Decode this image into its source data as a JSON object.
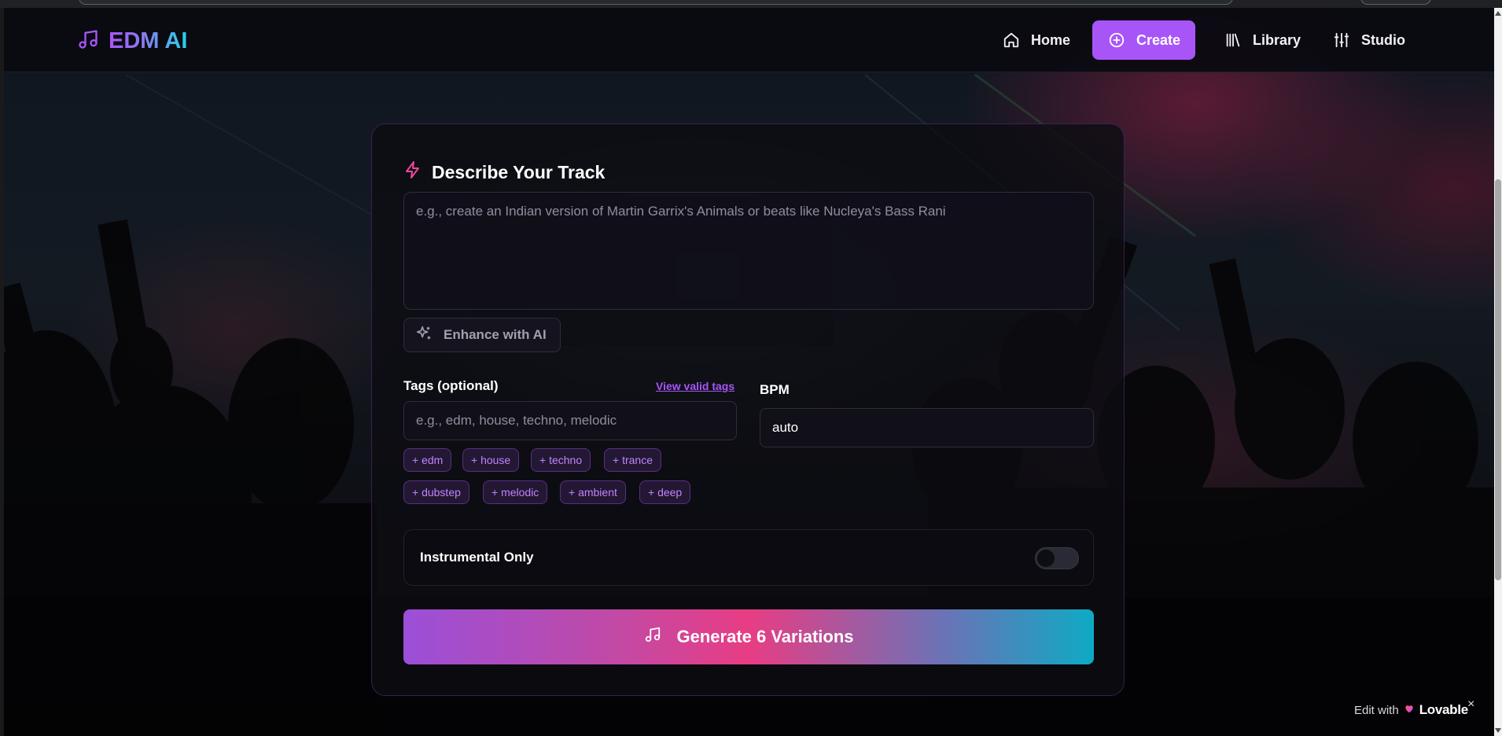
{
  "nav": {
    "logo_text": "EDM AI",
    "items": [
      {
        "label": "Home",
        "icon": "home-icon"
      },
      {
        "label": "Create",
        "icon": "plus-circle-icon",
        "active": true
      },
      {
        "label": "Library",
        "icon": "library-icon"
      },
      {
        "label": "Studio",
        "icon": "sliders-icon"
      }
    ]
  },
  "form": {
    "title": "Describe Your Track",
    "description_placeholder": "e.g., create an Indian version of Martin Garrix's Animals or beats like Nucleya's Bass Rani",
    "enhance_label": "Enhance with AI",
    "tags": {
      "label": "Tags (optional)",
      "view_link": "View valid tags",
      "placeholder": "e.g., edm, house, techno, melodic",
      "suggestions": [
        "+ edm",
        "+ house",
        "+ techno",
        "+ trance",
        "+ dubstep",
        "+ melodic",
        "+ ambient",
        "+ deep"
      ]
    },
    "bpm": {
      "label": "BPM",
      "value": "auto"
    },
    "instrumental": {
      "label": "Instrumental Only",
      "enabled": false
    },
    "generate_label": "Generate 6 Variations"
  },
  "badge": {
    "prefix": "Edit with",
    "brand": "Lovable",
    "close": "×"
  },
  "colors": {
    "accent": "#a855f7",
    "pink": "#ec4899",
    "cyan": "#06b6d4"
  }
}
